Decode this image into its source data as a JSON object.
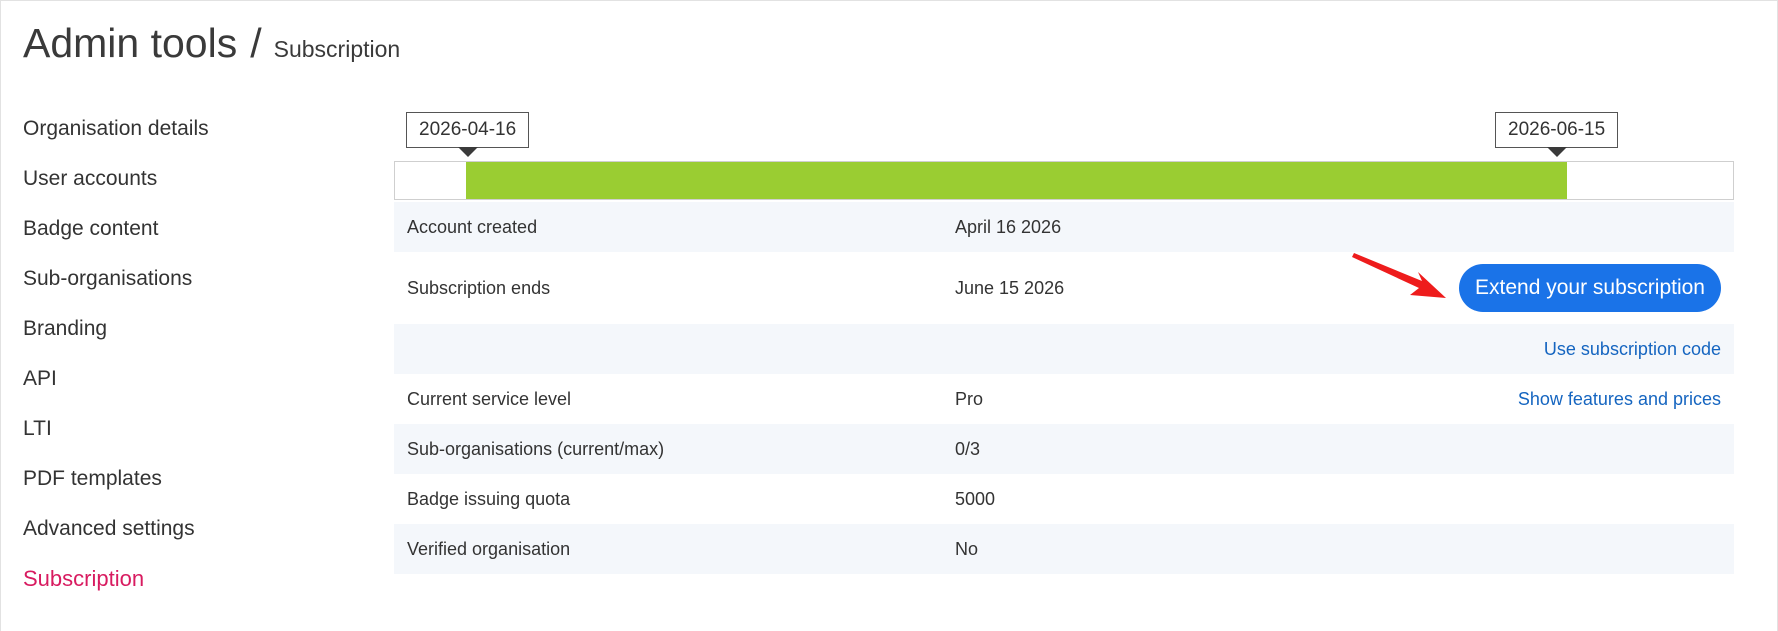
{
  "header": {
    "title": "Admin tools",
    "separator": "/",
    "subtitle": "Subscription"
  },
  "sidebar": {
    "items": [
      {
        "label": "Organisation details"
      },
      {
        "label": "User accounts"
      },
      {
        "label": "Badge content"
      },
      {
        "label": "Sub-organisations"
      },
      {
        "label": "Branding"
      },
      {
        "label": "API"
      },
      {
        "label": "LTI"
      },
      {
        "label": "PDF templates"
      },
      {
        "label": "Advanced settings"
      },
      {
        "label": "Subscription",
        "active": true
      }
    ]
  },
  "timeline": {
    "start_label": "2026-04-16",
    "end_label": "2026-06-15",
    "fill_color": "#9acd32",
    "fill_start_fraction": 0.053,
    "fill_end_fraction": 0.876
  },
  "details": {
    "account_created": {
      "label": "Account created",
      "value": "April 16 2026"
    },
    "subscription_ends": {
      "label": "Subscription ends",
      "value": "June 15 2026"
    },
    "extend_button": "Extend your subscription",
    "use_code_link": "Use subscription code",
    "service_level": {
      "label": "Current service level",
      "value": "Pro"
    },
    "features_link": "Show features and prices",
    "sub_orgs": {
      "label": "Sub-organisations (current/max)",
      "value": "0/3"
    },
    "quota": {
      "label": "Badge issuing quota",
      "value": "5000"
    },
    "verified": {
      "label": "Verified organisation",
      "value": "No"
    }
  },
  "colors": {
    "accent": "#1a73e8",
    "link": "#1565c0",
    "active_nav": "#d81b60",
    "annotation_arrow": "#ee1c1c"
  },
  "icons": {
    "annotation": "red-arrow-icon"
  }
}
